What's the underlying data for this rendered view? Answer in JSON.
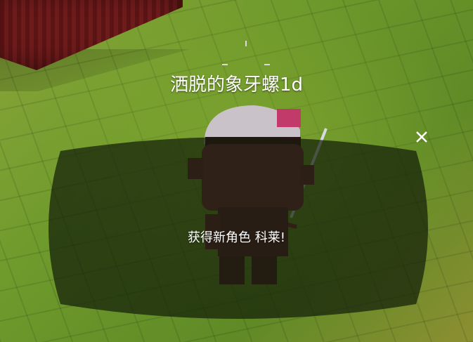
{
  "hud": {
    "character_name": "洒脱的象牙螺1d"
  },
  "dialog": {
    "message": "获得新角色 科莱!",
    "close_icon": "close-icon"
  },
  "colors": {
    "floor": "#6f9a2c",
    "wall": "#6e1b1b",
    "dialog_overlay": "rgba(20,30,10,0.72)",
    "text": "#ffffff"
  }
}
